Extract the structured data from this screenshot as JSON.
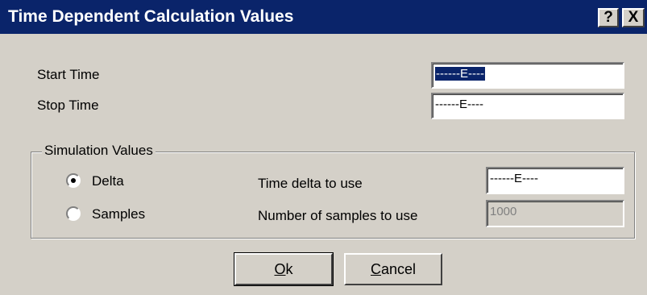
{
  "window": {
    "title": "Time Dependent Calculation Values",
    "help_label": "?",
    "close_label": "X"
  },
  "fields": {
    "start_time": {
      "label": "Start Time",
      "value": "------E----"
    },
    "stop_time": {
      "label": "Stop Time",
      "value": "------E----"
    }
  },
  "simulation": {
    "group_title": "Simulation Values",
    "delta": {
      "label": "Delta",
      "selected": true,
      "field_label": "Time delta to use",
      "value": "------E----"
    },
    "samples": {
      "label": "Samples",
      "selected": false,
      "field_label": "Number of samples to use",
      "value": "1000"
    }
  },
  "buttons": {
    "ok": {
      "mnemonic": "O",
      "rest": "k"
    },
    "cancel": {
      "mnemonic": "C",
      "rest": "ancel"
    }
  },
  "colors": {
    "titlebar": "#0a246a",
    "face": "#d4d0c8",
    "selection": "#0a246a"
  }
}
